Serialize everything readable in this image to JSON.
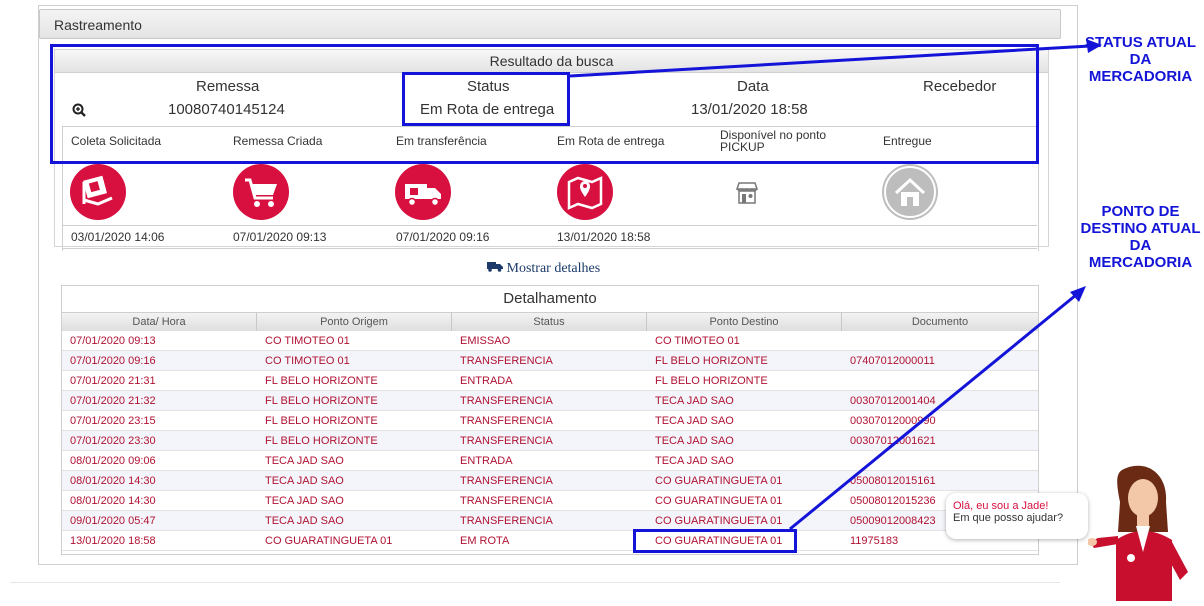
{
  "panel": {
    "title": "Rastreamento"
  },
  "result": {
    "title": "Resultado da busca",
    "headers": {
      "remessa": "Remessa",
      "status": "Status",
      "data": "Data",
      "recebedor": "Recebedor"
    },
    "values": {
      "remessa": "10080740145124",
      "status": "Em Rota de entrega",
      "data": "13/01/2020 18:58",
      "recebedor": ""
    }
  },
  "steps": [
    {
      "label": "Coleta Solicitada",
      "date": "03/01/2020 14:06",
      "icon": "parcel-icon",
      "active": true
    },
    {
      "label": "Remessa Criada",
      "date": "07/01/2020 09:13",
      "icon": "cart-icon",
      "active": true
    },
    {
      "label": "Em transferência",
      "date": "07/01/2020 09:16",
      "icon": "truck-icon",
      "active": true
    },
    {
      "label": "Em Rota de entrega",
      "date": "13/01/2020 18:58",
      "icon": "map-pin-icon",
      "active": true
    },
    {
      "label": "Disponível no ponto PICKUP",
      "date": "",
      "icon": "store-icon",
      "active": false
    },
    {
      "label": "Entregue",
      "date": "",
      "icon": "home-icon",
      "active": false
    }
  ],
  "show_details": "Mostrar detalhes",
  "detail": {
    "title": "Detalhamento",
    "columns": [
      "Data/ Hora",
      "Ponto Origem",
      "Status",
      "Ponto Destino",
      "Documento"
    ],
    "rows": [
      [
        "07/01/2020 09:13",
        "CO TIMOTEO 01",
        "EMISSAO",
        "CO TIMOTEO 01",
        ""
      ],
      [
        "07/01/2020 09:16",
        "CO TIMOTEO 01",
        "TRANSFERENCIA",
        "FL BELO HORIZONTE",
        "07407012000011"
      ],
      [
        "07/01/2020 21:31",
        "FL BELO HORIZONTE",
        "ENTRADA",
        "FL BELO HORIZONTE",
        ""
      ],
      [
        "07/01/2020 21:32",
        "FL BELO HORIZONTE",
        "TRANSFERENCIA",
        "TECA JAD SAO",
        "00307012001404"
      ],
      [
        "07/01/2020 23:15",
        "FL BELO HORIZONTE",
        "TRANSFERENCIA",
        "TECA JAD SAO",
        "00307012000990"
      ],
      [
        "07/01/2020 23:30",
        "FL BELO HORIZONTE",
        "TRANSFERENCIA",
        "TECA JAD SAO",
        "00307012001621"
      ],
      [
        "08/01/2020 09:06",
        "TECA JAD SAO",
        "ENTRADA",
        "TECA JAD SAO",
        ""
      ],
      [
        "08/01/2020 14:30",
        "TECA JAD SAO",
        "TRANSFERENCIA",
        "CO GUARATINGUETA 01",
        "05008012015161"
      ],
      [
        "08/01/2020 14:30",
        "TECA JAD SAO",
        "TRANSFERENCIA",
        "CO GUARATINGUETA 01",
        "05008012015236"
      ],
      [
        "09/01/2020 05:47",
        "TECA JAD SAO",
        "TRANSFERENCIA",
        "CO GUARATINGUETA 01",
        "05009012008423"
      ],
      [
        "13/01/2020 18:58",
        "CO GUARATINGUETA 01",
        "EM ROTA",
        "CO GUARATINGUETA 01",
        "11975183"
      ]
    ]
  },
  "annotations": {
    "status_note": "STATUS ATUAL DA MERCADORIA",
    "destino_note": "PONTO DE DESTINO ATUAL DA MERCADORIA",
    "color": "#1414d8"
  },
  "chat": {
    "line1": "Olá, eu sou a Jade!",
    "line2": "Em que posso ajudar?"
  },
  "colors": {
    "brand_red": "#d7103f",
    "inactive_grey": "#bdbdbd"
  }
}
